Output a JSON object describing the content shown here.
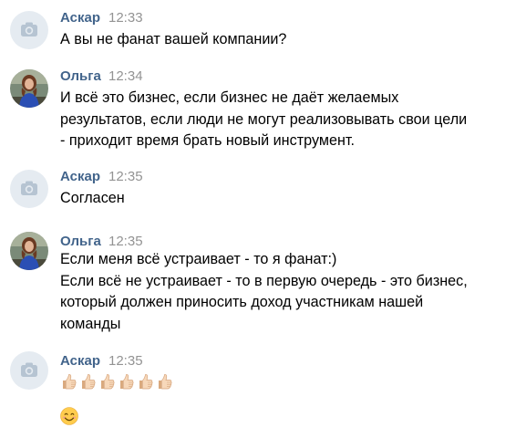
{
  "messages": [
    {
      "author": "Аскар",
      "time": "12:33",
      "avatar_icon": "camera-placeholder-icon",
      "lines": [
        "А вы не фанат вашей компании?"
      ]
    },
    {
      "author": "Ольга",
      "time": "12:34",
      "avatar_icon": "user-photo",
      "lines": [
        "И всё это бизнес, если бизнес не даёт желаемых",
        "результатов, если люди не могут реализовывать свои цели",
        "- приходит время брать новый инструмент."
      ]
    },
    {
      "author": "Аскар",
      "time": "12:35",
      "avatar_icon": "camera-placeholder-icon",
      "lines": [
        "Согласен"
      ]
    },
    {
      "author": "Ольга",
      "time": "12:35",
      "avatar_icon": "user-photo",
      "lines": [
        "Если меня всё устраивает - то я фанат:)",
        "Если всё не устраивает - то в первую очередь - это бизнес,",
        "который должен приносить доход участникам нашей",
        "команды"
      ]
    },
    {
      "author": "Аскар",
      "time": "12:35",
      "avatar_icon": "camera-placeholder-icon",
      "emoji_rows": [
        {
          "icon": "thumbs-up-icon",
          "count": 6
        },
        {
          "icon": "smiling-face-icon",
          "count": 1
        }
      ]
    }
  ],
  "colors": {
    "author_name": "#42648b",
    "timestamp": "#939393",
    "text": "#000000",
    "avatar_placeholder_bg": "#e5ebf1",
    "avatar_placeholder_icon": "#b6c4d2"
  }
}
